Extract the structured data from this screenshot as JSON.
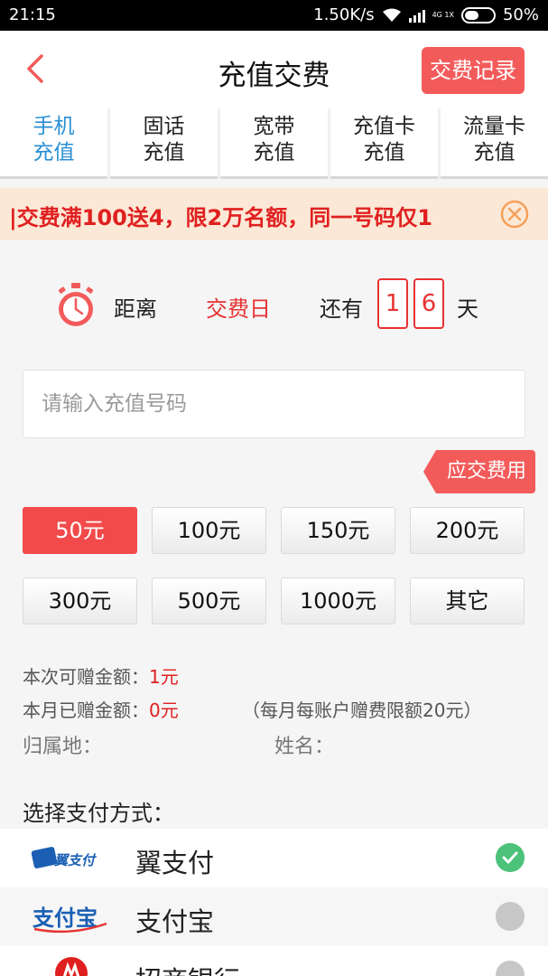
{
  "status_bar": {
    "time": "21:15",
    "speed": "1.50K/s",
    "network": "4G 1X",
    "battery": "50%",
    "battery_level": 0.5
  },
  "header": {
    "title": "充值交费",
    "record_button": "交费记录"
  },
  "tabs": [
    {
      "line1": "手机",
      "line2": "充值",
      "active": true
    },
    {
      "line1": "固话",
      "line2": "充值"
    },
    {
      "line1": "宽带",
      "line2": "充值"
    },
    {
      "line1": "充值卡",
      "line2": "充值"
    },
    {
      "line1": "流量卡",
      "line2": "充值"
    }
  ],
  "notice": {
    "text": "|交费满100送4，限2万名额，同一号码仅1"
  },
  "countdown": {
    "label_before": "距离",
    "label_day": "交费日",
    "label_remaining": "还有",
    "digit1": "1",
    "digit2": "6",
    "label_unit": "天"
  },
  "phone_input": {
    "placeholder": "请输入充值号码",
    "value": ""
  },
  "fee_tag": "应交费用",
  "amounts": [
    "50元",
    "100元",
    "150元",
    "200元",
    "300元",
    "500元",
    "1000元",
    "其它"
  ],
  "selected_amount": "50元",
  "info": {
    "gift_label": "本次可赠金额：",
    "gift_value": "1元",
    "month_label": "本月已赠金额：",
    "month_value": "0元",
    "limit_note": "（每月每账户赠费限额20元）",
    "location_label": "归属地：",
    "name_label": "姓名："
  },
  "payment": {
    "title": "选择支付方式：",
    "methods": [
      {
        "label": "翼支付",
        "logo_text": "翼支付",
        "selected": true
      },
      {
        "label": "支付宝",
        "logo_text": "支付宝",
        "selected": false
      },
      {
        "label": "招商银行",
        "selected": false
      }
    ]
  },
  "colors": {
    "accent": "#f35b5b",
    "tab_active": "#2a8fd4",
    "selected_check": "#4cc27a"
  }
}
